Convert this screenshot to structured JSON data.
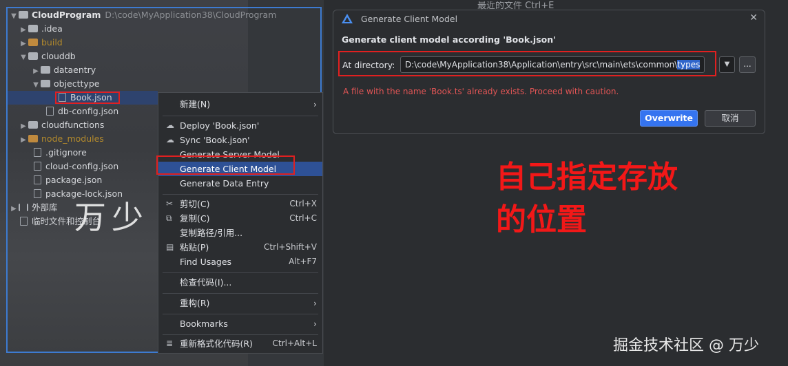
{
  "project_tree": {
    "root_name": "CloudProgram",
    "root_path": "D:\\code\\MyApplication38\\CloudProgram",
    "items": [
      {
        "label": ".idea"
      },
      {
        "label": "build"
      },
      {
        "label": "clouddb"
      },
      {
        "label": "dataentry"
      },
      {
        "label": "objecttype"
      },
      {
        "label": "Book.json"
      },
      {
        "label": "db-config.json"
      },
      {
        "label": "cloudfunctions"
      },
      {
        "label": "node_modules"
      },
      {
        "label": ".gitignore"
      },
      {
        "label": "cloud-config.json"
      },
      {
        "label": "package.json"
      },
      {
        "label": "package-lock.json"
      },
      {
        "label": "外部库"
      },
      {
        "label": "临时文件和控制台"
      }
    ]
  },
  "watermark": "万少",
  "context_menu": {
    "items": [
      {
        "label": "新建(N)",
        "shortcut": ""
      },
      {
        "label": "Deploy 'Book.json'",
        "shortcut": ""
      },
      {
        "label": "Sync 'Book.json'",
        "shortcut": ""
      },
      {
        "label": "Generate Server Model",
        "shortcut": ""
      },
      {
        "label": "Generate Client Model",
        "shortcut": ""
      },
      {
        "label": "Generate Data Entry",
        "shortcut": ""
      },
      {
        "label": "剪切(C)",
        "shortcut": "Ctrl+X"
      },
      {
        "label": "复制(C)",
        "shortcut": "Ctrl+C"
      },
      {
        "label": "复制路径/引用...",
        "shortcut": ""
      },
      {
        "label": "粘贴(P)",
        "shortcut": "Ctrl+Shift+V"
      },
      {
        "label": "Find Usages",
        "shortcut": "Alt+F7"
      },
      {
        "label": "检查代码(I)...",
        "shortcut": ""
      },
      {
        "label": "重构(R)",
        "shortcut": ""
      },
      {
        "label": "Bookmarks",
        "shortcut": ""
      },
      {
        "label": "重新格式化代码(R)",
        "shortcut": "Ctrl+Alt+L"
      }
    ]
  },
  "dialog": {
    "title": "Generate Client Model",
    "heading": "Generate client model according 'Book.json'",
    "directory_label": "At directory:",
    "directory_value_prefix": "D:\\code\\MyApplication38\\Application\\entry\\src\\main\\ets\\common\\",
    "directory_value_selected": "types",
    "warning": "A file with the name 'Book.ts' already exists. Proceed with caution.",
    "ok_label": "Overwrite",
    "cancel_label": "取消",
    "browse_label": "..."
  },
  "background_text": "最近的文件 Ctrl+E",
  "annotation": {
    "line1": "自己指定存放",
    "line2": "的位置"
  },
  "credit": "掘金技术社区 @ 万少",
  "colors": {
    "accent": "#3574f0",
    "highlight_box": "#e02020",
    "annotation": "#f21818",
    "warning": "#e05555"
  }
}
